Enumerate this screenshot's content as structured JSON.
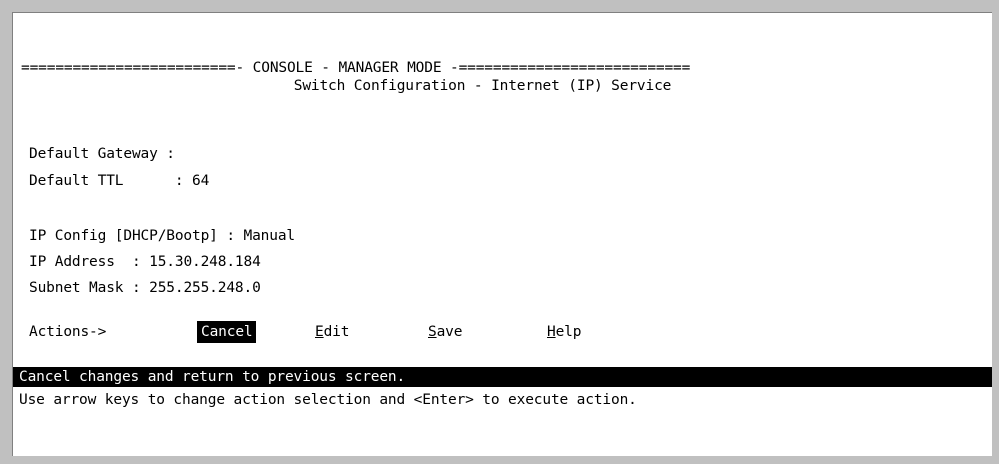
{
  "header": {
    "mode_line": "=========================- CONSOLE - MANAGER MODE -===========================",
    "title": "Switch Configuration - Internet (IP) Service"
  },
  "fields": {
    "default_gateway": {
      "label": "Default Gateway :",
      "value": ""
    },
    "default_ttl": {
      "label": "Default TTL      : ",
      "value": "64"
    },
    "ip_config": {
      "label": "IP Config [DHCP/Bootp] : ",
      "value": "Manual"
    },
    "ip_address": {
      "label": "IP Address  : ",
      "value": "15.30.248.184"
    },
    "subnet_mask": {
      "label": "Subnet Mask : ",
      "value": "255.255.248.0"
    }
  },
  "actions": {
    "label": "Actions->",
    "cancel": "Cancel",
    "edit_hot": "E",
    "edit_rest": "dit",
    "save_hot": "S",
    "save_rest": "ave",
    "help_hot": "H",
    "help_rest": "elp"
  },
  "status": {
    "message": "Cancel changes and return to previous screen.",
    "hint": "Use arrow keys to change action selection and <Enter> to execute action."
  }
}
